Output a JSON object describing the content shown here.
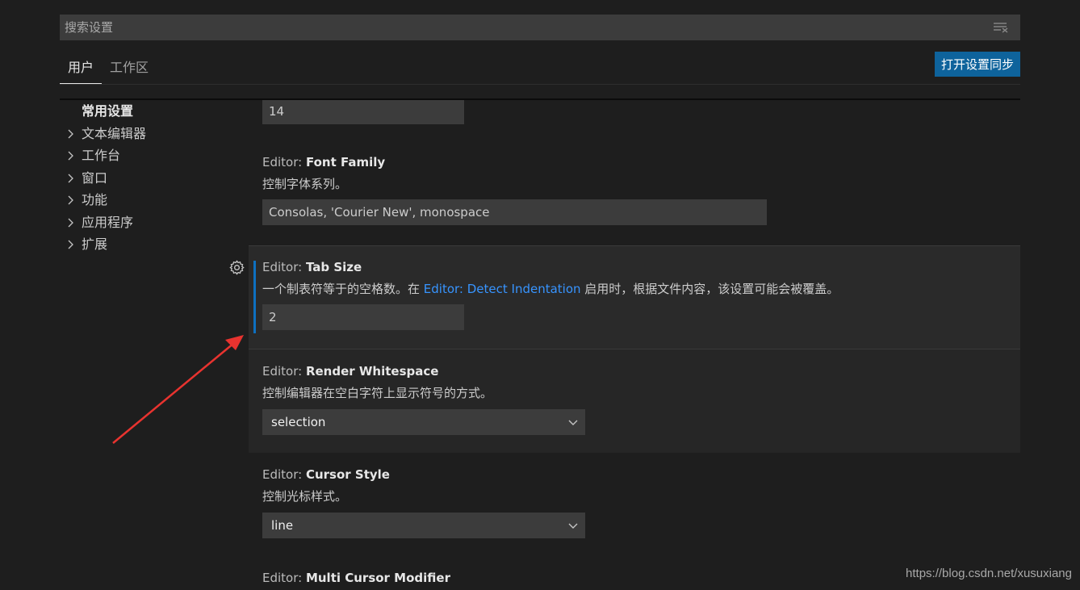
{
  "search": {
    "placeholder": "搜索设置"
  },
  "tabs": [
    {
      "label": "用户",
      "active": true
    },
    {
      "label": "工作区",
      "active": false
    }
  ],
  "sync_button": {
    "label": "打开设置同步"
  },
  "toc": {
    "items": [
      {
        "label": "常用设置",
        "expandable": false
      },
      {
        "label": "文本编辑器",
        "expandable": true
      },
      {
        "label": "工作台",
        "expandable": true
      },
      {
        "label": "窗口",
        "expandable": true
      },
      {
        "label": "功能",
        "expandable": true
      },
      {
        "label": "应用程序",
        "expandable": true
      },
      {
        "label": "扩展",
        "expandable": true
      }
    ]
  },
  "settings": {
    "font_size": {
      "value": "14"
    },
    "font_family": {
      "prefix": "Editor: ",
      "name": "Font Family",
      "description": "控制字体系列。",
      "value": "Consolas, 'Courier New', monospace"
    },
    "tab_size": {
      "prefix": "Editor: ",
      "name": "Tab Size",
      "description_before": "一个制表符等于的空格数。在 ",
      "description_link": "Editor: Detect Indentation",
      "description_after": " 启用时，根据文件内容，该设置可能会被覆盖。",
      "value": "2"
    },
    "render_whitespace": {
      "prefix": "Editor: ",
      "name": "Render Whitespace",
      "description": "控制编辑器在空白字符上显示符号的方式。",
      "value": "selection"
    },
    "cursor_style": {
      "prefix": "Editor: ",
      "name": "Cursor Style",
      "description": "控制光标样式。",
      "value": "line"
    },
    "multi_cursor_modifier": {
      "prefix": "Editor: ",
      "name": "Multi Cursor Modifier"
    }
  },
  "watermark": "https://blog.csdn.net/xusuxiang",
  "colors": {
    "background": "#1e1e1e",
    "input_background": "#3c3c3c",
    "accent": "#0e639c",
    "link": "#3794ff",
    "focus_bar": "#0e70c0",
    "annotation_arrow": "#e8332f"
  },
  "icons": {
    "clear_filter": "clear-filter-icon",
    "chevron": "chevron-right-icon",
    "gear": "gear-icon",
    "select": "chevron-down-icon"
  }
}
